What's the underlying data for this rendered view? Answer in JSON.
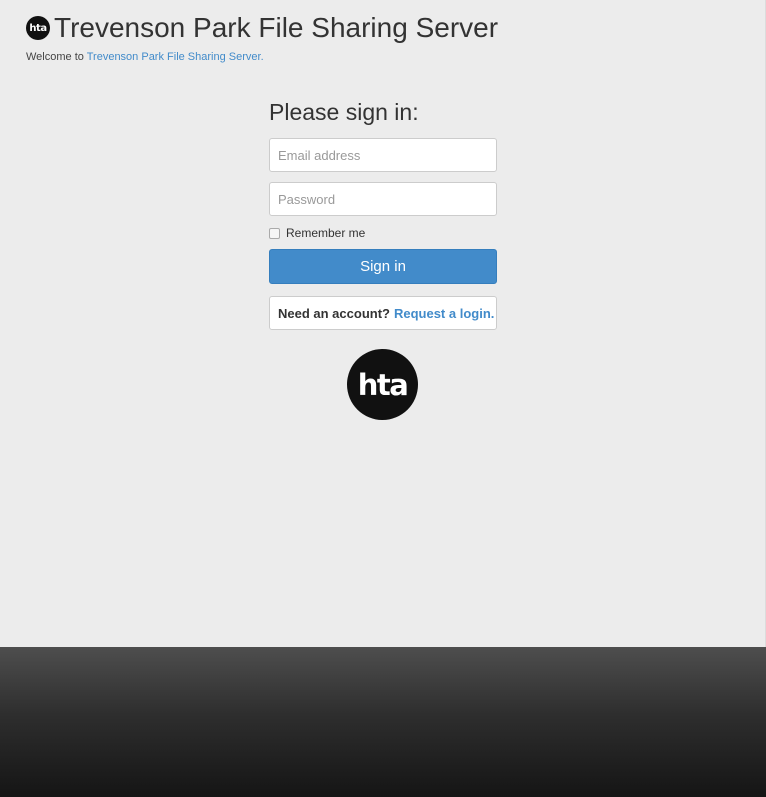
{
  "header": {
    "logo_text": "hta",
    "title": "Trevenson Park File Sharing Server"
  },
  "welcome": {
    "prefix": "Welcome to ",
    "link_text": "Trevenson Park File Sharing Server."
  },
  "signin": {
    "heading": "Please sign in:",
    "email_placeholder": "Email address",
    "password_placeholder": "Password",
    "remember_label": "Remember me",
    "button_label": "Sign in",
    "account_prompt": "Need an account?",
    "account_link": "Request a login.",
    "remember_checked": false
  },
  "brand": {
    "logo_text": "hta"
  },
  "colors": {
    "background": "#ececec",
    "accent": "#428bca",
    "footer": "#2e2e2e"
  }
}
